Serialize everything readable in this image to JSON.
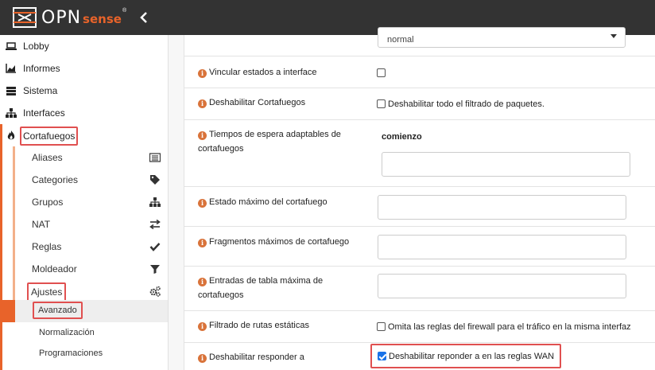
{
  "brand": {
    "name": "OPN",
    "sense": "sense",
    "reg": "®"
  },
  "topbar": {
    "collapse_icon": "chevron-left-icon",
    "bg": "#333333",
    "accent": "#e8632a"
  },
  "sidebar": {
    "items": [
      {
        "label": "Lobby",
        "icon": "laptop-icon"
      },
      {
        "label": "Informes",
        "icon": "area-chart-icon"
      },
      {
        "label": "Sistema",
        "icon": "server-icon"
      },
      {
        "label": "Interfaces",
        "icon": "sitemap-icon"
      },
      {
        "label": "Cortafuegos",
        "icon": "fire-icon"
      }
    ],
    "sub_items": [
      {
        "label": "Aliases",
        "icon": "list-alt-icon"
      },
      {
        "label": "Categories",
        "icon": "tags-icon"
      },
      {
        "label": "Grupos",
        "icon": "sitemap-icon"
      },
      {
        "label": "NAT",
        "icon": "exchange-icon"
      },
      {
        "label": "Reglas",
        "icon": "check-icon"
      },
      {
        "label": "Moldeador",
        "icon": "filter-icon"
      },
      {
        "label": "Ajustes",
        "icon": "cogs-icon"
      }
    ],
    "subsub_items": [
      {
        "label": "Avanzado"
      },
      {
        "label": "Normalización"
      },
      {
        "label": "Programaciones"
      }
    ]
  },
  "form": {
    "top_select": {
      "value": "normal"
    },
    "rows": [
      {
        "label": "Vincular estados a interface"
      },
      {
        "label": "Deshabilitar Cortafuegos",
        "checkbox_label": "Deshabilitar todo el filtrado de paquetes."
      },
      {
        "label": "Tiempos de espera adaptables de cortafuegos",
        "sub_heading": "comienzo"
      },
      {
        "label": "Estado máximo del cortafuego"
      },
      {
        "label": "Fragmentos máximos de cortafuego"
      },
      {
        "label": "Entradas de tabla máxima de cortafuegos"
      },
      {
        "label": "Filtrado de rutas estáticas",
        "checkbox_label": "Omita las reglas del firewall para el tráfico en la misma interfaz"
      },
      {
        "label": "Deshabilitar responder a",
        "checkbox_label": "Deshabilitar reponder a en las reglas WAN",
        "checked": true
      }
    ]
  }
}
